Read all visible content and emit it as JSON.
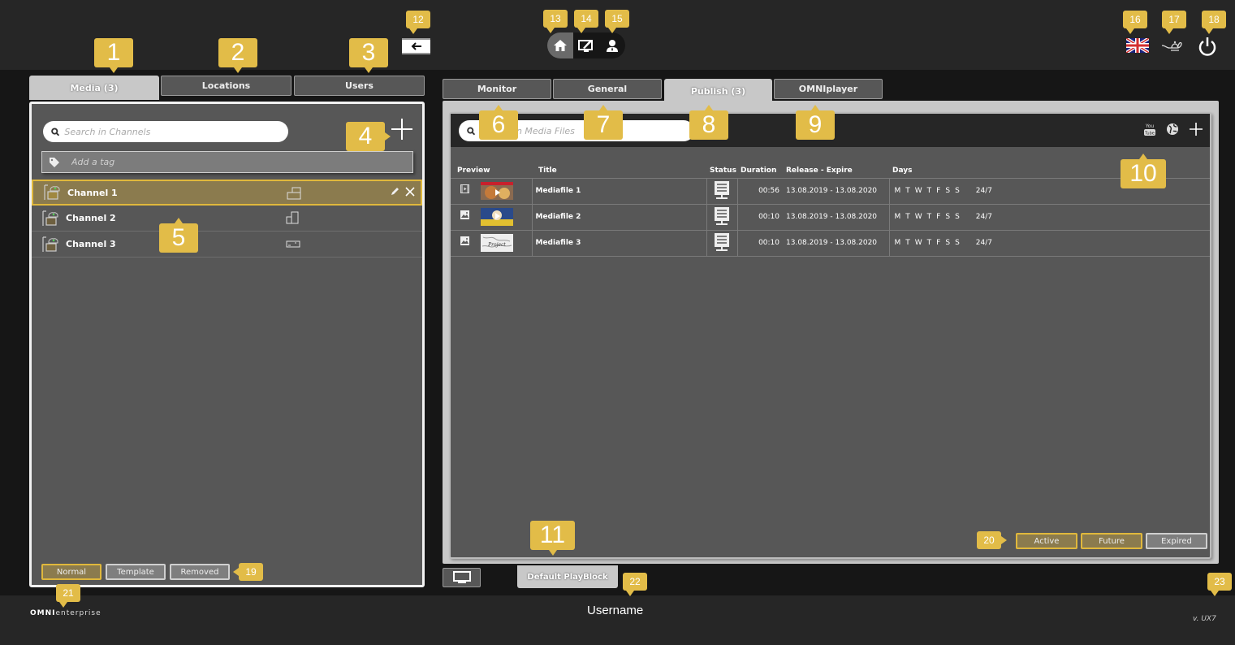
{
  "left_tabs": [
    {
      "label": "Media (3)",
      "active": true
    },
    {
      "label": "Locations",
      "active": false
    },
    {
      "label": "Users",
      "active": false
    }
  ],
  "collapse_button": {
    "icon": "arrow-left-icon"
  },
  "main_nav": [
    {
      "icon": "home-icon",
      "active": true
    },
    {
      "icon": "edit-screen-icon",
      "active": false
    },
    {
      "icon": "user-icon",
      "active": false
    }
  ],
  "top_right": {
    "language_icon": "uk-flag-icon",
    "genie_icon": "magic-lamp-icon",
    "power_icon": "power-icon"
  },
  "channels_panel": {
    "search_placeholder": "Search in Channels",
    "tag_placeholder": "Add a tag",
    "add_icon": "plus-icon",
    "channels": [
      {
        "name": "Channel 1",
        "orientation": "landscape",
        "selected": true
      },
      {
        "name": "Channel 2",
        "orientation": "portrait",
        "selected": false
      },
      {
        "name": "Channel 3",
        "orientation": "landscape-small",
        "selected": false
      }
    ],
    "filters": [
      {
        "label": "Normal",
        "active": true
      },
      {
        "label": "Template",
        "active": false
      },
      {
        "label": "Removed",
        "active": false
      }
    ]
  },
  "right_tabs": [
    {
      "label": "Monitor",
      "active": false
    },
    {
      "label": "General",
      "active": false
    },
    {
      "label": "Publish (3)",
      "active": true
    },
    {
      "label": "OMNIplayer",
      "active": false
    }
  ],
  "media_panel": {
    "search_placeholder": "Search in Media Files",
    "header_icons": [
      "youtube-icon",
      "globe-icon",
      "plus-icon"
    ],
    "columns": [
      "Preview",
      "Title",
      "Status",
      "Duration",
      "Release - Expire",
      "Days"
    ],
    "rows": [
      {
        "type": "video",
        "title": "Mediafile 1",
        "duration": "00:56",
        "release_expire": "13.08.2019 - 13.08.2020",
        "days": [
          "M",
          "T",
          "W",
          "T",
          "F",
          "S",
          "S"
        ],
        "schedule": "24/7"
      },
      {
        "type": "image",
        "title": "Mediafile 2",
        "duration": "00:10",
        "release_expire": "13.08.2019 - 13.08.2020",
        "days": [
          "M",
          "T",
          "W",
          "T",
          "F",
          "S",
          "S"
        ],
        "schedule": "24/7"
      },
      {
        "type": "image",
        "title": "Mediafile 3",
        "duration": "00:10",
        "release_expire": "13.08.2019 - 13.08.2020",
        "days": [
          "M",
          "T",
          "W",
          "T",
          "F",
          "S",
          "S"
        ],
        "schedule": "24/7"
      }
    ],
    "status_filters": [
      {
        "label": "Active",
        "active": true
      },
      {
        "label": "Future",
        "active": true
      },
      {
        "label": "Expired",
        "active": false
      }
    ]
  },
  "playblock_tab": "Default PlayBlock",
  "footer": {
    "logo_bold": "OMNI",
    "logo_rest": "enterprise",
    "username": "Username",
    "version": "v. UX7"
  },
  "annotations": [
    "1",
    "2",
    "3",
    "4",
    "5",
    "6",
    "7",
    "8",
    "9",
    "10",
    "11",
    "12",
    "13",
    "14",
    "15",
    "16",
    "17",
    "18",
    "19",
    "20",
    "21",
    "22",
    "23"
  ],
  "colors": {
    "accent": "#e2bc48",
    "selected_row": "#8b7b4e",
    "panel": "#575757",
    "background": "#262626"
  }
}
